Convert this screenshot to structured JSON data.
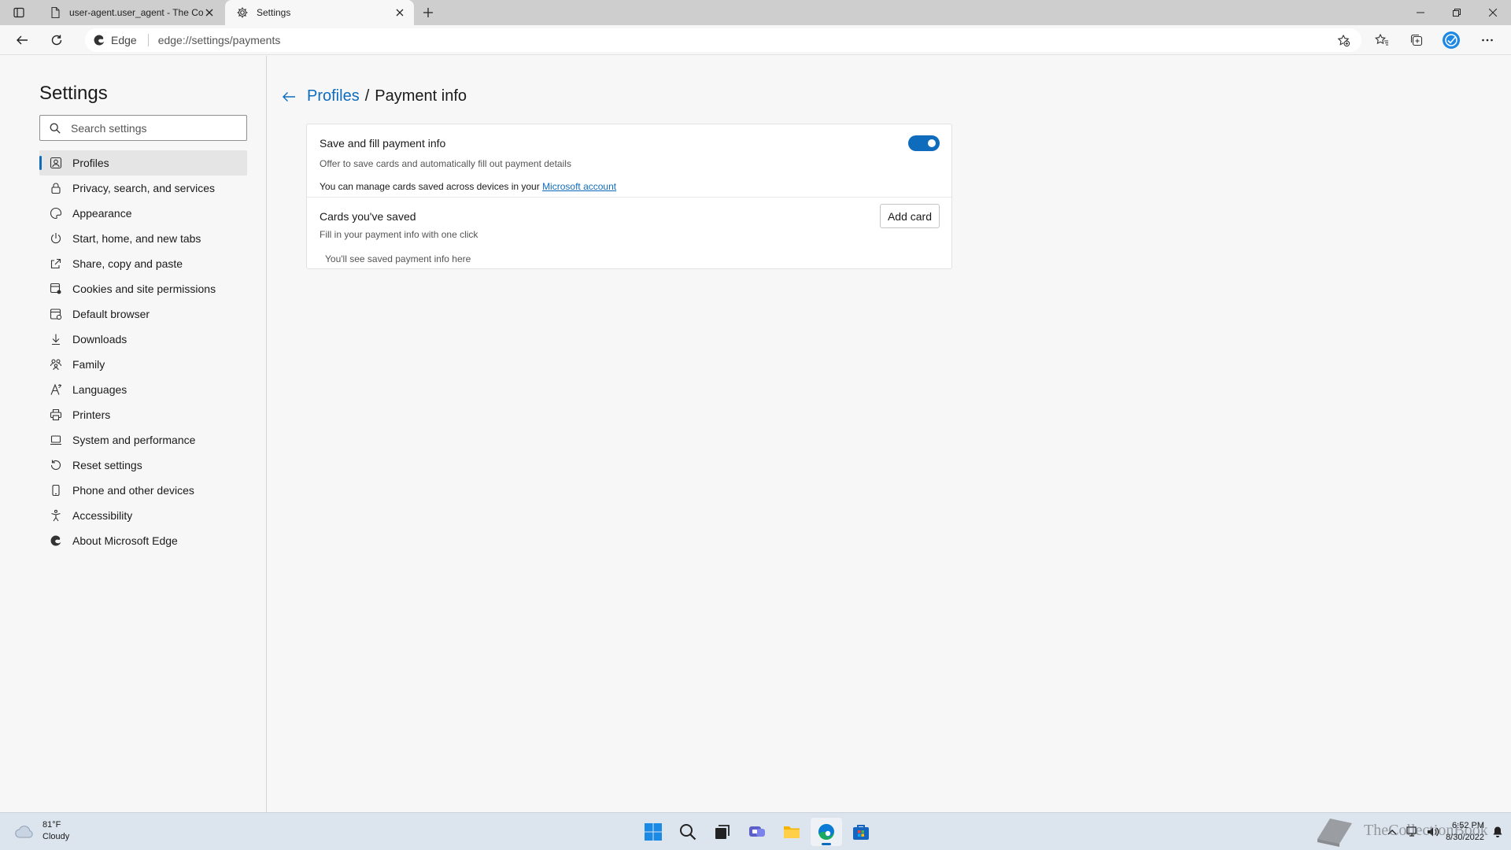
{
  "tabs": [
    {
      "title": "user-agent.user_agent - The Coll",
      "icon": "page-icon",
      "active": false
    },
    {
      "title": "Settings",
      "icon": "gear-icon",
      "active": true
    }
  ],
  "address": {
    "site_label": "Edge",
    "url": "edge://settings/payments"
  },
  "sidebar": {
    "title": "Settings",
    "search_placeholder": "Search settings",
    "items": [
      {
        "label": "Profiles",
        "icon": "profile-icon",
        "selected": true
      },
      {
        "label": "Privacy, search, and services",
        "icon": "lock-icon"
      },
      {
        "label": "Appearance",
        "icon": "appearance-icon"
      },
      {
        "label": "Start, home, and new tabs",
        "icon": "power-icon"
      },
      {
        "label": "Share, copy and paste",
        "icon": "share-icon"
      },
      {
        "label": "Cookies and site permissions",
        "icon": "cookies-icon"
      },
      {
        "label": "Default browser",
        "icon": "browser-icon"
      },
      {
        "label": "Downloads",
        "icon": "download-icon"
      },
      {
        "label": "Family",
        "icon": "family-icon"
      },
      {
        "label": "Languages",
        "icon": "languages-icon"
      },
      {
        "label": "Printers",
        "icon": "printer-icon"
      },
      {
        "label": "System and performance",
        "icon": "laptop-icon"
      },
      {
        "label": "Reset settings",
        "icon": "reset-icon"
      },
      {
        "label": "Phone and other devices",
        "icon": "phone-icon"
      },
      {
        "label": "Accessibility",
        "icon": "accessibility-icon"
      },
      {
        "label": "About Microsoft Edge",
        "icon": "edge-icon"
      }
    ]
  },
  "breadcrumb": {
    "parent": "Profiles",
    "separator": "/",
    "current": "Payment info"
  },
  "payment": {
    "save_title": "Save and fill payment info",
    "save_subtitle": "Offer to save cards and automatically fill out payment details",
    "manage_note": "You can manage cards saved across devices in your",
    "manage_link": "Microsoft account",
    "toggle_on": true,
    "cards_title": "Cards you've saved",
    "cards_subtitle": "Fill in your payment info with one click",
    "add_card_label": "Add card",
    "empty_note": "You'll see saved payment info here"
  },
  "taskbar": {
    "temperature": "81°F",
    "condition": "Cloudy",
    "time": "6:52 PM",
    "date": "8/30/2022",
    "watermark": "TheCollectionBook"
  },
  "colors": {
    "accent": "#0f6cbd",
    "taskbar": "#dce4ee"
  }
}
